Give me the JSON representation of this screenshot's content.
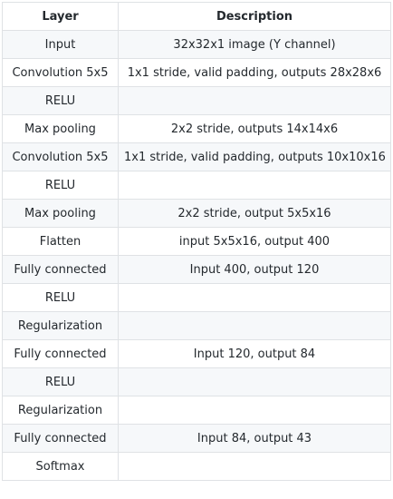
{
  "table": {
    "headers": [
      "Layer",
      "Description"
    ],
    "rows": [
      [
        "Input",
        "32x32x1 image (Y channel)"
      ],
      [
        "Convolution 5x5",
        "1x1 stride, valid padding, outputs 28x28x6"
      ],
      [
        "RELU",
        ""
      ],
      [
        "Max pooling",
        "2x2 stride, outputs 14x14x6"
      ],
      [
        "Convolution 5x5",
        "1x1 stride, valid padding, outputs 10x10x16"
      ],
      [
        "RELU",
        ""
      ],
      [
        "Max pooling",
        "2x2 stride, output 5x5x16"
      ],
      [
        "Flatten",
        "input 5x5x16, output 400"
      ],
      [
        "Fully connected",
        "Input 400, output 120"
      ],
      [
        "RELU",
        ""
      ],
      [
        "Regularization",
        ""
      ],
      [
        "Fully connected",
        "Input 120, output 84"
      ],
      [
        "RELU",
        ""
      ],
      [
        "Regularization",
        ""
      ],
      [
        "Fully connected",
        "Input 84, output 43"
      ],
      [
        "Softmax",
        ""
      ]
    ]
  }
}
